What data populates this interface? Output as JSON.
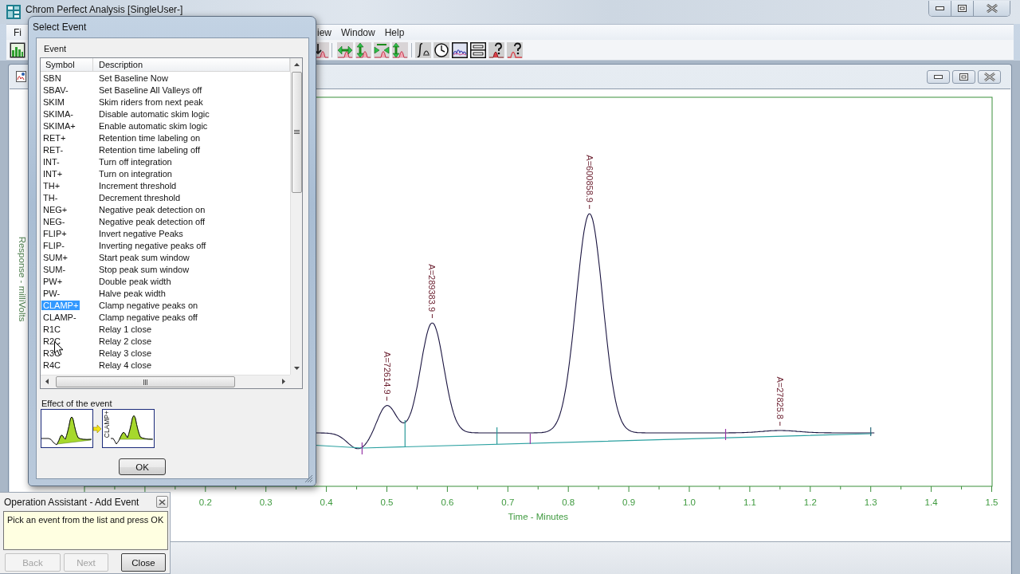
{
  "window": {
    "title": "Chrom Perfect Analysis [SingleUser-]"
  },
  "menu": [
    "Fi",
    "iew",
    "Window",
    "Help"
  ],
  "chart": {
    "ylabel": "Response - milliVolts",
    "x_tick_labels": [
      "0.2",
      "0.3",
      "0.4",
      "0.5",
      "0.6",
      "0.7",
      "0.8",
      "0.9",
      "1.0",
      "1.1",
      "1.2",
      "1.3",
      "1.4",
      "1.5"
    ],
    "xlabel": "Time - Minutes",
    "peak_labels": [
      "A=72614.9",
      "A=289383.9",
      "A=600858.9",
      "A=27825.8"
    ]
  },
  "select_event": {
    "title": "Select Event",
    "group_label": "Event",
    "columns": [
      "Symbol",
      "Description"
    ],
    "rows": [
      {
        "symbol": "SBN",
        "description": "Set Baseline Now",
        "selected": false
      },
      {
        "symbol": "SBAV-",
        "description": "Set Baseline All Valleys off",
        "selected": false
      },
      {
        "symbol": "SKIM",
        "description": "Skim riders from next peak",
        "selected": false
      },
      {
        "symbol": "SKIMA-",
        "description": "Disable automatic skim logic",
        "selected": false
      },
      {
        "symbol": "SKIMA+",
        "description": "Enable automatic skim logic",
        "selected": false
      },
      {
        "symbol": "RET+",
        "description": "Retention time labeling on",
        "selected": false
      },
      {
        "symbol": "RET-",
        "description": "Retention time labeling off",
        "selected": false
      },
      {
        "symbol": "INT-",
        "description": "Turn off integration",
        "selected": false
      },
      {
        "symbol": "INT+",
        "description": "Turn on integration",
        "selected": false
      },
      {
        "symbol": "TH+",
        "description": "Increment threshold",
        "selected": false
      },
      {
        "symbol": "TH-",
        "description": "Decrement threshold",
        "selected": false
      },
      {
        "symbol": "NEG+",
        "description": "Negative peak detection on",
        "selected": false
      },
      {
        "symbol": "NEG-",
        "description": "Negative peak detection off",
        "selected": false
      },
      {
        "symbol": "FLIP+",
        "description": "Invert negative Peaks",
        "selected": false
      },
      {
        "symbol": "FLIP-",
        "description": "Inverting negative peaks off",
        "selected": false
      },
      {
        "symbol": "SUM+",
        "description": "Start peak sum window",
        "selected": false
      },
      {
        "symbol": "SUM-",
        "description": "Stop peak sum window",
        "selected": false
      },
      {
        "symbol": "PW+",
        "description": "Double peak width",
        "selected": false
      },
      {
        "symbol": "PW-",
        "description": "Halve peak width",
        "selected": false
      },
      {
        "symbol": "CLAMP+",
        "description": "Clamp negative peaks on",
        "selected": true
      },
      {
        "symbol": "CLAMP-",
        "description": "Clamp negative peaks off",
        "selected": false
      },
      {
        "symbol": "R1C",
        "description": "Relay 1 close",
        "selected": false
      },
      {
        "symbol": "R2C",
        "description": "Relay 2 close",
        "selected": false
      },
      {
        "symbol": "R3C",
        "description": "Relay 3 close",
        "selected": false
      },
      {
        "symbol": "R4C",
        "description": "Relay 4 close",
        "selected": false
      }
    ],
    "effect_label": "Effect of the event",
    "effect_after_label": "CLAMP+",
    "ok_button": "OK"
  },
  "operation_assistant": {
    "title": "Operation Assistant - Add Event",
    "message": "Pick an event from the list and press OK",
    "buttons": [
      {
        "label": "Back",
        "disabled": true
      },
      {
        "label": "Next",
        "disabled": true
      },
      {
        "label": "Close",
        "disabled": false
      }
    ]
  }
}
